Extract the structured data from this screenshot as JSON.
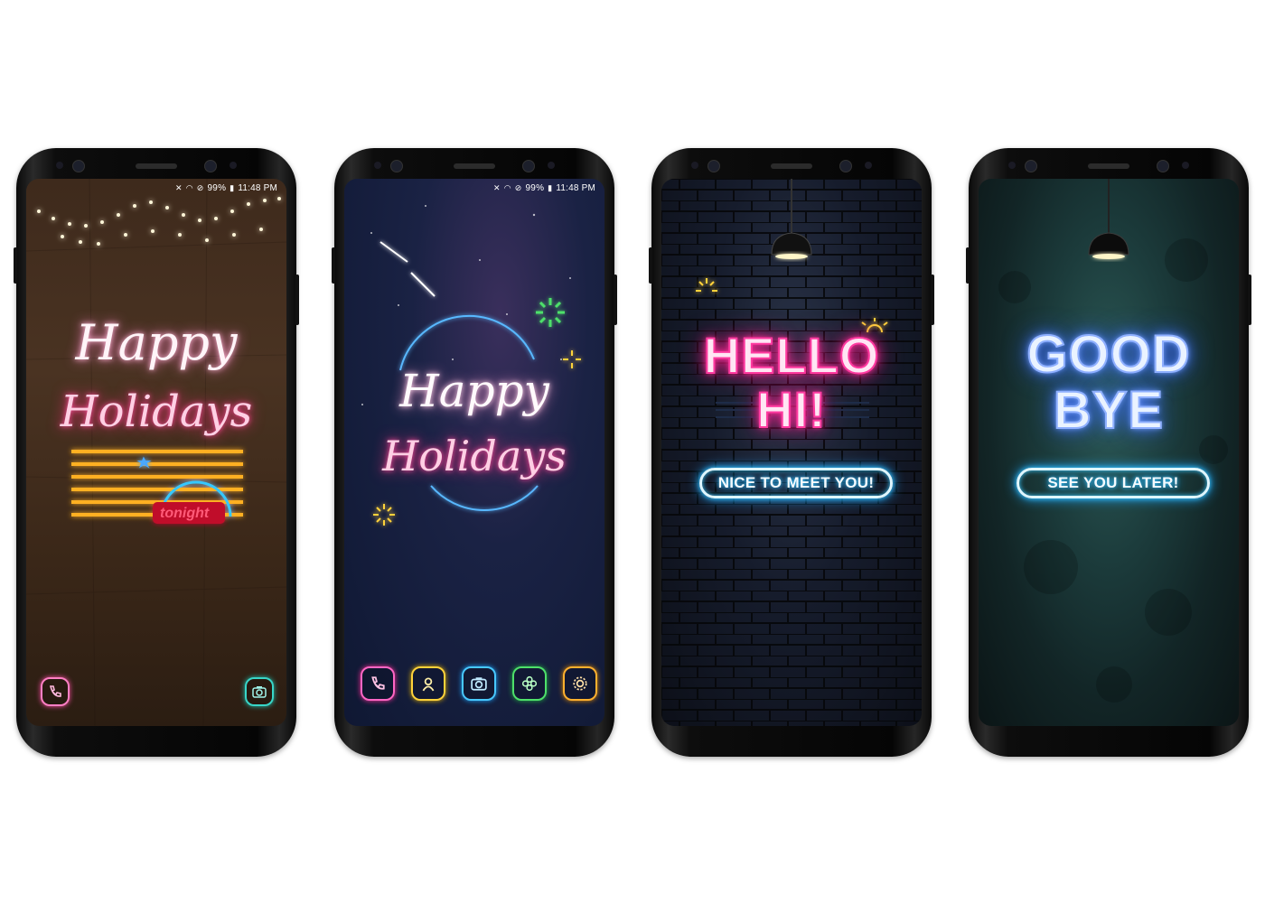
{
  "status_bar": {
    "battery": "99%",
    "time": "11:48 PM"
  },
  "phone1": {
    "wallpaper_text": {
      "line1": "Happy",
      "line2": "Holidays"
    },
    "sign_text": "tonight",
    "icons": {
      "left": "phone-icon",
      "right": "camera-icon"
    },
    "colors": {
      "pink": "#ff7fc4",
      "teal": "#38d6c8"
    }
  },
  "phone2": {
    "wallpaper_text": {
      "line1": "Happy",
      "line2": "Holidays"
    },
    "dock_icons": [
      "phone-icon",
      "contacts-icon",
      "camera-icon",
      "gallery-icon",
      "settings-icon"
    ],
    "colors": {
      "pink": "#ff66c4",
      "yellow": "#ffd23a",
      "blue": "#48c8ff",
      "green": "#4ee06a",
      "orange": "#ffb02e"
    }
  },
  "phone3": {
    "headline": {
      "line1": "HELLO",
      "line2": "HI!"
    },
    "pill": "NICE TO MEET YOU!"
  },
  "phone4": {
    "headline": {
      "line1": "GOOD",
      "line2": "BYE"
    },
    "pill": "SEE YOU LATER!"
  }
}
